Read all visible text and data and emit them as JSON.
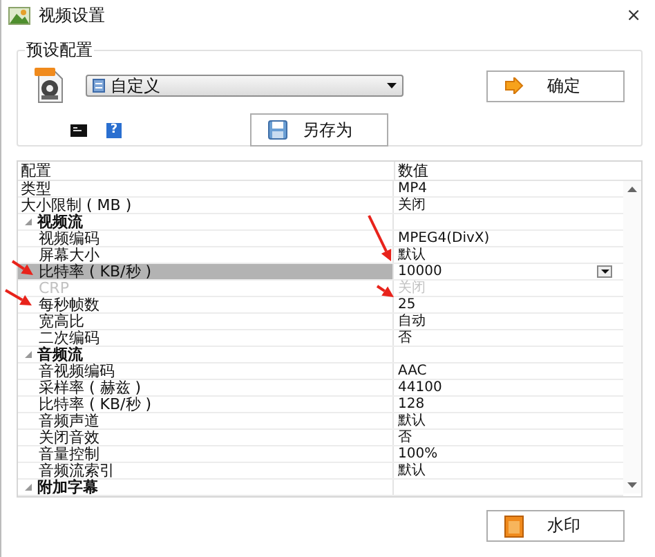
{
  "window": {
    "title": "视频设置",
    "close": "×"
  },
  "preset": {
    "title": "预设配置",
    "profile": {
      "value": "自定义"
    },
    "help": "?",
    "ok_button": {
      "label": "确定"
    },
    "save_as_button": {
      "label": "另存为"
    }
  },
  "table": {
    "columns": [
      "配置",
      "数值"
    ],
    "rows": [
      {
        "kind": "item",
        "name": "类型",
        "value": "MP4",
        "selected": false,
        "disabled": false
      },
      {
        "kind": "item",
        "name": "大小限制 ( MB )",
        "value": "关闭",
        "selected": false,
        "disabled": false
      },
      {
        "kind": "group",
        "name": "视频流",
        "expanded": true,
        "children": [
          {
            "kind": "item",
            "name": "视频编码",
            "value": "MPEG4(DivX)",
            "selected": false,
            "disabled": false
          },
          {
            "kind": "item",
            "name": "屏幕大小",
            "value": "默认",
            "selected": false,
            "disabled": false
          },
          {
            "kind": "item",
            "name": "比特率 ( KB/秒 )",
            "value": "10000",
            "selected": true,
            "disabled": false
          },
          {
            "kind": "item",
            "name": "CRP",
            "value": "关闭",
            "selected": false,
            "disabled": true
          },
          {
            "kind": "item",
            "name": "每秒帧数",
            "value": "25",
            "selected": false,
            "disabled": false
          },
          {
            "kind": "item",
            "name": "宽高比",
            "value": "自动",
            "selected": false,
            "disabled": false
          },
          {
            "kind": "item",
            "name": "二次编码",
            "value": "否",
            "selected": false,
            "disabled": false
          }
        ]
      },
      {
        "kind": "group",
        "name": "音频流",
        "expanded": true,
        "children": [
          {
            "kind": "item",
            "name": "音视频编码",
            "value": "AAC",
            "selected": false,
            "disabled": false
          },
          {
            "kind": "item",
            "name": "采样率 ( 赫兹 )",
            "value": "44100",
            "selected": false,
            "disabled": false
          },
          {
            "kind": "item",
            "name": "比特率 ( KB/秒 )",
            "value": "128",
            "selected": false,
            "disabled": false
          },
          {
            "kind": "item",
            "name": "音频声道",
            "value": "默认",
            "selected": false,
            "disabled": false
          },
          {
            "kind": "item",
            "name": "关闭音效",
            "value": "否",
            "selected": false,
            "disabled": false
          },
          {
            "kind": "item",
            "name": "音量控制",
            "value": "100%",
            "selected": false,
            "disabled": false
          },
          {
            "kind": "item",
            "name": "音频流索引",
            "value": "默认",
            "selected": false,
            "disabled": false
          }
        ]
      },
      {
        "kind": "group",
        "name": "附加字幕",
        "expanded": true
      }
    ]
  },
  "watermark_button": {
    "label": "水印"
  }
}
